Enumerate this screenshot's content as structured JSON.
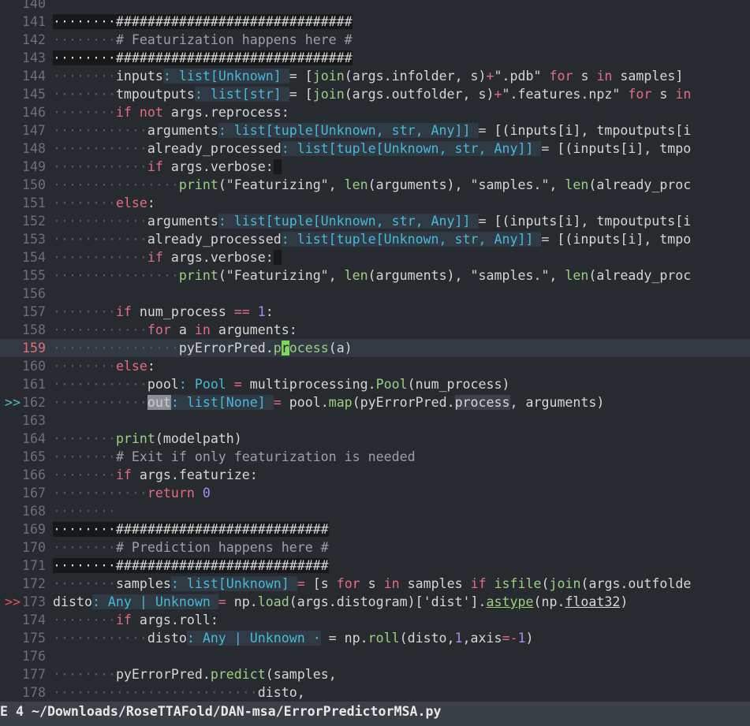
{
  "editor": {
    "lines": [
      {
        "num": "140",
        "mark": "",
        "segs": []
      },
      {
        "num": "141",
        "mark": "",
        "segs": [
          [
            "hashbg",
            "········##############################"
          ]
        ]
      },
      {
        "num": "142",
        "mark": "",
        "segs": [
          [
            "ind",
            "········"
          ],
          [
            "cm",
            "# Featurization happens here #"
          ]
        ]
      },
      {
        "num": "143",
        "mark": "",
        "segs": [
          [
            "hashbg",
            "········##############################"
          ]
        ]
      },
      {
        "num": "144",
        "mark": "",
        "segs": [
          [
            "ind",
            "········"
          ],
          [
            "",
            "inputs"
          ],
          [
            "tyb",
            ": list[Unknown] "
          ],
          [
            "",
            "= ["
          ],
          [
            "fn",
            "join"
          ],
          [
            "",
            "(args.infolder, s)"
          ],
          [
            "op",
            "+"
          ],
          [
            "st",
            "\".pdb\" "
          ],
          [
            "kw",
            "for"
          ],
          [
            "",
            " s "
          ],
          [
            "kw",
            "in"
          ],
          [
            "",
            " samples]"
          ]
        ]
      },
      {
        "num": "145",
        "mark": "",
        "segs": [
          [
            "ind",
            "········"
          ],
          [
            "",
            "tmpoutputs"
          ],
          [
            "tyb",
            ": list[str] "
          ],
          [
            "",
            "= ["
          ],
          [
            "fn",
            "join"
          ],
          [
            "",
            "(args.outfolder, s)"
          ],
          [
            "op",
            "+"
          ],
          [
            "st",
            "\".features.npz\" "
          ],
          [
            "kw",
            "for"
          ],
          [
            "",
            " s "
          ],
          [
            "kw",
            "in"
          ]
        ]
      },
      {
        "num": "146",
        "mark": "",
        "segs": [
          [
            "ind",
            "········"
          ],
          [
            "kw",
            "if not"
          ],
          [
            "",
            " args.reprocess:"
          ]
        ]
      },
      {
        "num": "147",
        "mark": "",
        "segs": [
          [
            "ind",
            "············"
          ],
          [
            "",
            "arguments"
          ],
          [
            "tyb",
            ": list[tuple[Unknown, str, Any]] "
          ],
          [
            "",
            "= [(inputs[i], tmpoutputs[i"
          ]
        ]
      },
      {
        "num": "148",
        "mark": "",
        "segs": [
          [
            "ind",
            "············"
          ],
          [
            "",
            "already_processed"
          ],
          [
            "tyb",
            ": list[tuple[Unknown, str, Any]] "
          ],
          [
            "",
            "= [(inputs[i], tmpo"
          ]
        ]
      },
      {
        "num": "149",
        "mark": "",
        "segs": [
          [
            "ind",
            "············"
          ],
          [
            "kw",
            "if"
          ],
          [
            "",
            " args.verbose:"
          ],
          [
            "hashbg",
            " "
          ]
        ]
      },
      {
        "num": "150",
        "mark": "",
        "segs": [
          [
            "ind",
            "················"
          ],
          [
            "fn",
            "print"
          ],
          [
            "",
            "(\"Featurizing\", "
          ],
          [
            "fn",
            "len"
          ],
          [
            "",
            "(arguments), \"samples.\", "
          ],
          [
            "fn",
            "len"
          ],
          [
            "",
            "(already_proc"
          ]
        ]
      },
      {
        "num": "151",
        "mark": "",
        "segs": [
          [
            "ind",
            "········"
          ],
          [
            "kw",
            "else"
          ],
          [
            "",
            ":"
          ]
        ]
      },
      {
        "num": "152",
        "mark": "",
        "segs": [
          [
            "ind",
            "············"
          ],
          [
            "",
            "arguments"
          ],
          [
            "tyb",
            ": list[tuple[Unknown, str, Any]] "
          ],
          [
            "",
            "= [(inputs[i], tmpoutputs[i"
          ]
        ]
      },
      {
        "num": "153",
        "mark": "",
        "segs": [
          [
            "ind",
            "············"
          ],
          [
            "",
            "already_processed"
          ],
          [
            "tyb",
            ": list[tuple[Unknown, str, Any]] "
          ],
          [
            "",
            "= [(inputs[i], tmpo"
          ]
        ]
      },
      {
        "num": "154",
        "mark": "",
        "segs": [
          [
            "ind",
            "············"
          ],
          [
            "kw",
            "if"
          ],
          [
            "",
            " args.verbose:"
          ],
          [
            "hashbg",
            " "
          ]
        ]
      },
      {
        "num": "155",
        "mark": "",
        "segs": [
          [
            "ind",
            "················"
          ],
          [
            "fn",
            "print"
          ],
          [
            "",
            "(\"Featurizing\", "
          ],
          [
            "fn",
            "len"
          ],
          [
            "",
            "(arguments), \"samples.\", "
          ],
          [
            "fn",
            "len"
          ],
          [
            "",
            "(already_proc"
          ]
        ]
      },
      {
        "num": "156",
        "mark": "",
        "segs": []
      },
      {
        "num": "157",
        "mark": "",
        "segs": [
          [
            "ind",
            "········"
          ],
          [
            "kw",
            "if"
          ],
          [
            "",
            " num_process "
          ],
          [
            "op",
            "=="
          ],
          [
            "",
            " "
          ],
          [
            "nm",
            "1"
          ],
          [
            "",
            ":"
          ]
        ]
      },
      {
        "num": "158",
        "mark": "",
        "segs": [
          [
            "ind",
            "············"
          ],
          [
            "kw",
            "for"
          ],
          [
            "",
            " a "
          ],
          [
            "kw",
            "in"
          ],
          [
            "",
            " arguments:"
          ]
        ]
      },
      {
        "num": "159",
        "mark": "",
        "current": true,
        "segs": [
          [
            "ind",
            "················"
          ],
          [
            "",
            "pyErrorPred."
          ],
          [
            "fn",
            "p"
          ],
          [
            "cur",
            "r"
          ],
          [
            "fn",
            "ocess"
          ],
          [
            "",
            "(a)"
          ]
        ]
      },
      {
        "num": "160",
        "mark": "",
        "segs": [
          [
            "ind",
            "········"
          ],
          [
            "kw",
            "else"
          ],
          [
            "",
            ":"
          ]
        ]
      },
      {
        "num": "161",
        "mark": "",
        "segs": [
          [
            "ind",
            "············"
          ],
          [
            "",
            "pool"
          ],
          [
            "ty",
            ": Pool "
          ],
          [
            "op",
            "="
          ],
          [
            "",
            " multiprocessing."
          ],
          [
            "fn",
            "Pool"
          ],
          [
            "",
            "(num_process)"
          ]
        ]
      },
      {
        "num": "162",
        "mark": ">>",
        "markclass": "blue",
        "segs": [
          [
            "ind",
            "············"
          ],
          [
            "sel",
            "out"
          ],
          [
            "tyb",
            ": list[None] "
          ],
          [
            "op",
            "="
          ],
          [
            "",
            " pool."
          ],
          [
            "fn",
            "map"
          ],
          [
            "",
            "(pyErrorPred."
          ],
          [
            "hl",
            "process"
          ],
          [
            "",
            ", arguments)"
          ]
        ]
      },
      {
        "num": "163",
        "mark": "",
        "segs": []
      },
      {
        "num": "164",
        "mark": "",
        "segs": [
          [
            "ind",
            "········"
          ],
          [
            "fn",
            "print"
          ],
          [
            "",
            "(modelpath)"
          ]
        ]
      },
      {
        "num": "165",
        "mark": "",
        "segs": [
          [
            "ind",
            "········"
          ],
          [
            "cm",
            "# Exit if only featurization is needed"
          ]
        ]
      },
      {
        "num": "166",
        "mark": "",
        "segs": [
          [
            "ind",
            "········"
          ],
          [
            "kw",
            "if"
          ],
          [
            "",
            " args.featurize:"
          ]
        ]
      },
      {
        "num": "167",
        "mark": "",
        "segs": [
          [
            "ind",
            "············"
          ],
          [
            "kw",
            "return"
          ],
          [
            "",
            " "
          ],
          [
            "nm",
            "0"
          ]
        ]
      },
      {
        "num": "168",
        "mark": "",
        "segs": [
          [
            "ind",
            "········"
          ]
        ]
      },
      {
        "num": "169",
        "mark": "",
        "segs": [
          [
            "hashbg",
            "········###########################"
          ]
        ]
      },
      {
        "num": "170",
        "mark": "",
        "segs": [
          [
            "ind",
            "········"
          ],
          [
            "cm",
            "# Prediction happens here #"
          ]
        ]
      },
      {
        "num": "171",
        "mark": "",
        "segs": [
          [
            "hashbg",
            "········###########################"
          ]
        ]
      },
      {
        "num": "172",
        "mark": "",
        "segs": [
          [
            "ind",
            "········"
          ],
          [
            "",
            "samples"
          ],
          [
            "tyb",
            ": list[Unknown] "
          ],
          [
            "op",
            "="
          ],
          [
            "",
            " [s "
          ],
          [
            "kw",
            "for"
          ],
          [
            "",
            " s "
          ],
          [
            "kw",
            "in"
          ],
          [
            "",
            " samples "
          ],
          [
            "kw",
            "if"
          ],
          [
            "",
            " "
          ],
          [
            "fn",
            "isfile"
          ],
          [
            "",
            "("
          ],
          [
            "fn",
            "join"
          ],
          [
            "",
            "(args.outfolde"
          ]
        ]
      },
      {
        "num": "173",
        "mark": ">>",
        "markclass": "",
        "segs": [
          [
            "ind",
            ""
          ],
          [
            "",
            "disto"
          ],
          [
            "tyb",
            ": Any | Unknown "
          ],
          [
            "op",
            "="
          ],
          [
            "",
            " np."
          ],
          [
            "fn",
            "load"
          ],
          [
            "",
            "(args.distogram)['dist']."
          ],
          [
            "fn ul",
            "astype"
          ],
          [
            "",
            "(np."
          ],
          [
            "ul",
            "float32"
          ],
          [
            ")",
            ")"
          ]
        ]
      },
      {
        "num": "174",
        "mark": "",
        "segs": [
          [
            "ind",
            "········"
          ],
          [
            "kw",
            "if"
          ],
          [
            "",
            " args.roll:"
          ]
        ]
      },
      {
        "num": "175",
        "mark": "",
        "segs": [
          [
            "ind",
            "············"
          ],
          [
            "",
            "disto"
          ],
          [
            "tyb",
            ": Any | Unknown ·"
          ],
          [
            "",
            " = np."
          ],
          [
            "fn",
            "roll"
          ],
          [
            "",
            "(disto,"
          ],
          [
            "nm",
            "1"
          ],
          [
            "",
            ",axis"
          ],
          [
            "op",
            "=-"
          ],
          [
            "nm",
            "1"
          ],
          [
            "",
            ")"
          ]
        ]
      },
      {
        "num": "176",
        "mark": "",
        "segs": []
      },
      {
        "num": "177",
        "mark": "",
        "segs": [
          [
            "ind",
            "········"
          ],
          [
            "",
            "pyErrorPred."
          ],
          [
            "fn",
            "predict"
          ],
          [
            "",
            "(samples,"
          ]
        ]
      },
      {
        "num": "178",
        "mark": "",
        "segs": [
          [
            "ind",
            "··························"
          ],
          [
            "",
            "disto,"
          ]
        ]
      }
    ]
  },
  "statusbar": {
    "text": "E 4 ~/Downloads/RoseTTAFold/DAN-msa/ErrorPredictorMSA.py"
  }
}
